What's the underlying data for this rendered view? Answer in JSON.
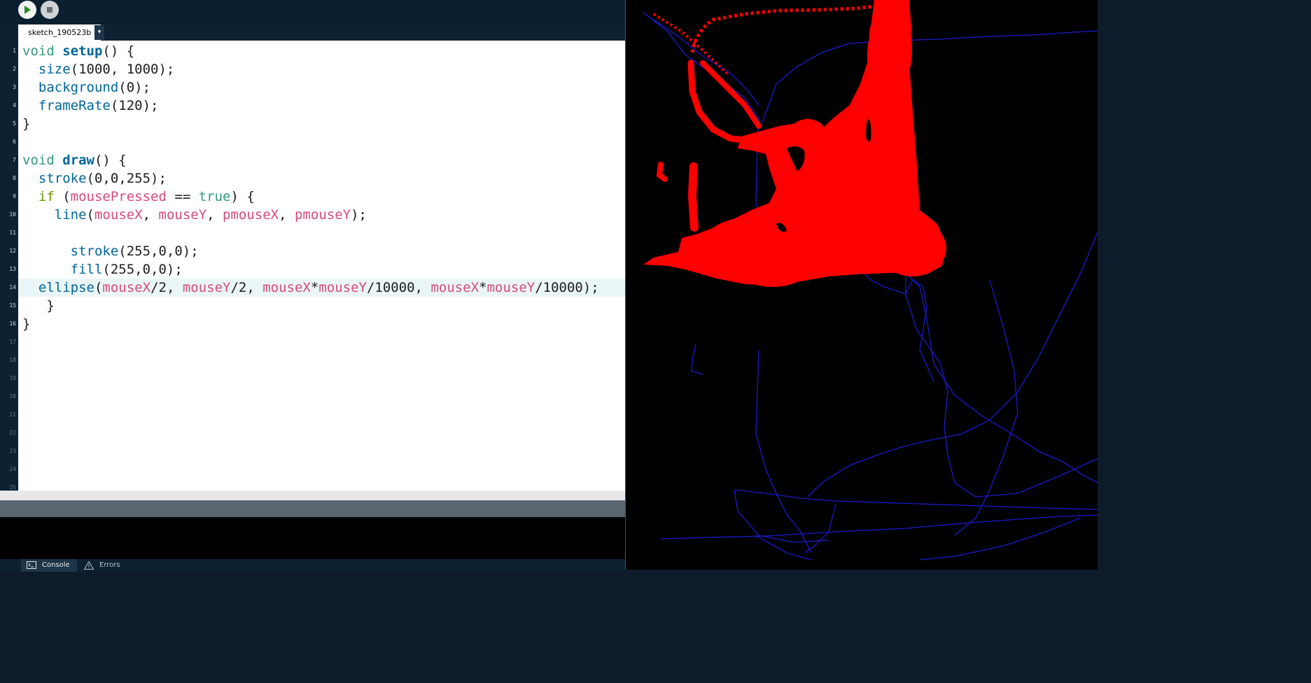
{
  "toolbar": {
    "run_icon": "play-icon",
    "stop_icon": "stop-icon"
  },
  "tab": {
    "label": "sketch_190523b",
    "menu_glyph": "▾"
  },
  "gutter": {
    "line_numbers": [
      "1",
      "2",
      "3",
      "4",
      "5",
      "6",
      "7",
      "8",
      "9",
      "10",
      "11",
      "12",
      "13",
      "14",
      "15",
      "16",
      "17",
      "18",
      "19",
      "20",
      "21",
      "22",
      "23",
      "24",
      "25"
    ]
  },
  "code": {
    "lines": [
      [
        "void",
        " ",
        "setup",
        "() {"
      ],
      [
        "  ",
        "size",
        "(1000, 1000);"
      ],
      [
        "  ",
        "background",
        "(0);"
      ],
      [
        "  ",
        "frameRate",
        "(120);"
      ],
      [
        "}"
      ],
      [
        ""
      ],
      [
        "void",
        " ",
        "draw",
        "() {"
      ],
      [
        "  ",
        "stroke",
        "(0,0,255);"
      ],
      [
        "  ",
        "if",
        " (",
        "mousePressed",
        " == ",
        "true",
        ") {"
      ],
      [
        "    ",
        "line",
        "(",
        "mouseX",
        ", ",
        "mouseY",
        ", ",
        "pmouseX",
        ", ",
        "pmouseY",
        ");"
      ],
      [
        ""
      ],
      [
        "      ",
        "stroke",
        "(255,0,0);"
      ],
      [
        "      ",
        "fill",
        "(255,0,0);"
      ],
      [
        "  ",
        "ellipse",
        "(",
        "mouseX",
        "/2, ",
        "mouseY",
        "/2, ",
        "mouseX",
        "*",
        "mouseY",
        "/10000, ",
        "mouseX",
        "*",
        "mouseY",
        "/10000);"
      ],
      [
        "   }"
      ],
      [
        "}"
      ]
    ]
  },
  "status": {
    "console_label": "Console",
    "errors_label": "Errors",
    "console_icon": "terminal-icon",
    "errors_icon": "warning-icon"
  },
  "sketch": {
    "background": "#000000",
    "stroke_red": "#ff0000",
    "stroke_blue": "#1a1acc"
  }
}
